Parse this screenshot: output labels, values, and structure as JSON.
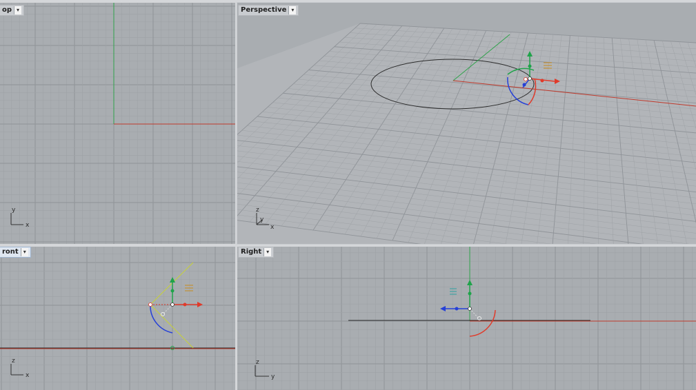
{
  "viewports": {
    "top": {
      "label": "op",
      "menu_icon": "chevron-down-icon",
      "axes": {
        "a": "y",
        "b": "x"
      }
    },
    "perspective": {
      "label": "Perspective",
      "menu_icon": "chevron-down-icon",
      "axes": {
        "a": "z",
        "b": "y",
        "c": "x"
      }
    },
    "front": {
      "label": "ront",
      "menu_icon": "chevron-down-icon",
      "axes": {
        "a": "z",
        "b": "x"
      }
    },
    "right": {
      "label": "Right",
      "menu_icon": "chevron-down-icon",
      "axes": {
        "a": "z",
        "b": "y"
      }
    }
  },
  "colors": {
    "background": "#a9adb1",
    "grid_minor": "#9ea2a6",
    "grid_major": "#8f9398",
    "x_axis": "#c0392b",
    "y_axis": "#2ea34a",
    "z_axis": "#2b46d6",
    "curve": "#2a2a2a",
    "gizmo_green": "#1fa34a",
    "gizmo_red": "#e03a2a",
    "gizmo_blue": "#2540d8",
    "yellow_line": "#c8d236",
    "orange_handle": "#c88a1a",
    "teal_handle": "#2aa0a0"
  }
}
